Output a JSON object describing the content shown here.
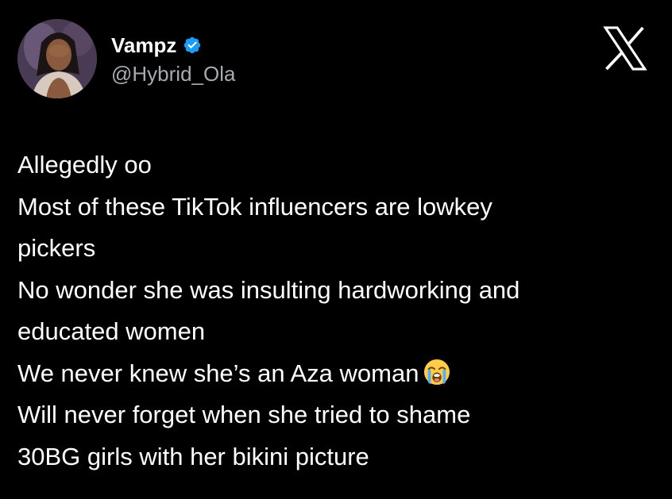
{
  "author": {
    "display_name": "Vampz",
    "handle": "@Hybrid_Ola",
    "verified": true,
    "avatar_icon": "profile-photo",
    "verified_icon": "verified-badge-icon",
    "verified_color": "#1d9bf0"
  },
  "brand": {
    "logo_icon": "x-logo-icon",
    "logo_color": "#ffffff"
  },
  "tweet": {
    "lines": [
      "Allegedly oo",
      "Most of these TikTok influencers are lowkey",
      "pickers",
      "No wonder she was insulting hardworking and",
      "educated women",
      "We never knew she’s an Aza woman",
      "Will never forget when she tried to shame",
      "30BG girls with her bikini picture"
    ],
    "emoji_icon": "loudly-crying-face-icon"
  },
  "colors": {
    "background": "#000000",
    "text_primary": "#ffffff",
    "text_secondary": "#a7abb0"
  }
}
